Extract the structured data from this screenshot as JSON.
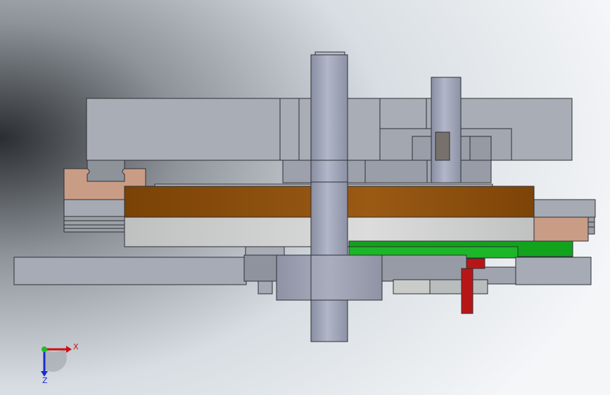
{
  "viewport": {
    "background_colors": [
      "#2a2d31",
      "#8d9399",
      "#d7dde2",
      "#f4f6f8"
    ]
  },
  "axis_triad": {
    "x_label": "X",
    "z_label": "Z",
    "x_color": "#cc1111",
    "z_color": "#1a2bd0",
    "y_color": "#22bb22"
  },
  "materials": {
    "housing": "#a9adb6",
    "housing_dark": "#8e929c",
    "shaft": "#a3a7ba",
    "bronze": "#8a4b0a",
    "steel_disc": "#cfd0d0",
    "copper_block": "#c99c86",
    "green_plate": "#12a31d",
    "red_pin": "#b81616",
    "light_block": "#c9ccc9"
  }
}
